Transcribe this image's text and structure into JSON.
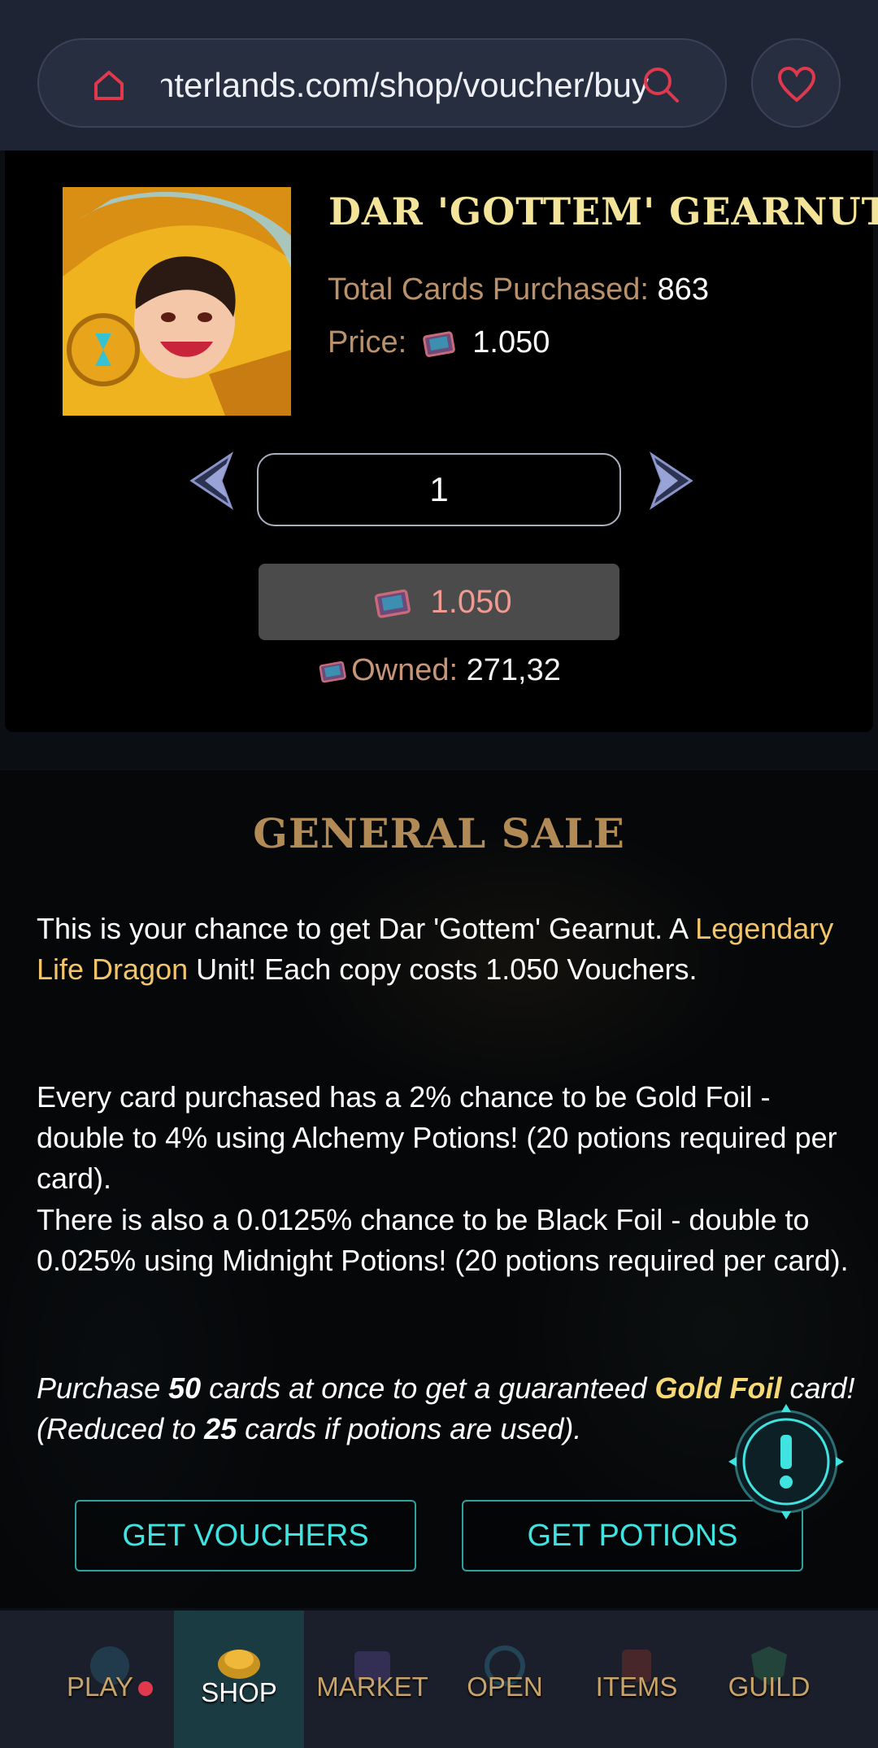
{
  "browser": {
    "url": "splinterlands.com/shop/voucher/buy"
  },
  "product": {
    "title": "DAR 'GOTTEM' GEARNUT",
    "total_label": "Total Cards Purchased:",
    "total_value": "863",
    "price_label": "Price:",
    "price_value": "1.050",
    "quantity": "1",
    "buy_label": "1.050",
    "owned_label": "Owned:",
    "owned_value": "271,32"
  },
  "sale": {
    "title": "GENERAL SALE",
    "p1_a": "This is your chance to get Dar 'Gottem' Gearnut. A ",
    "p1_hl": "Legendary Life Dragon",
    "p1_b": " Unit! Each copy costs 1.050 Vouchers.",
    "p2": "Every card purchased has a 2% chance to be Gold Foil - double to 4% using Alchemy Potions! (20 potions required per card).",
    "p3": "There is also a 0.0125% chance to be Black Foil - double to 0.025% using Midnight Potions! (20 potions required per card).",
    "p4_a": "Purchase ",
    "p4_n1": "50",
    "p4_b": " cards at once to get a guaranteed ",
    "p4_gold": "Gold Foil",
    "p4_c": " card! (Reduced to ",
    "p4_n2": "25",
    "p4_d": " cards if potions are used).",
    "btn_vouchers": "GET VOUCHERS",
    "btn_potions": "GET POTIONS"
  },
  "nav": {
    "play": "PLAY",
    "shop": "SHOP",
    "market": "MARKET",
    "open": "OPEN",
    "items": "ITEMS",
    "guild": "GUILD"
  },
  "colors": {
    "accent_gold": "#f4e49a",
    "accent_teal": "#3fe3e0",
    "alert_red": "#e0384d"
  },
  "icons": [
    "home-icon",
    "search-icon",
    "heart-icon",
    "voucher-icon",
    "chevron-left-icon",
    "chevron-right-icon",
    "alert-icon"
  ]
}
